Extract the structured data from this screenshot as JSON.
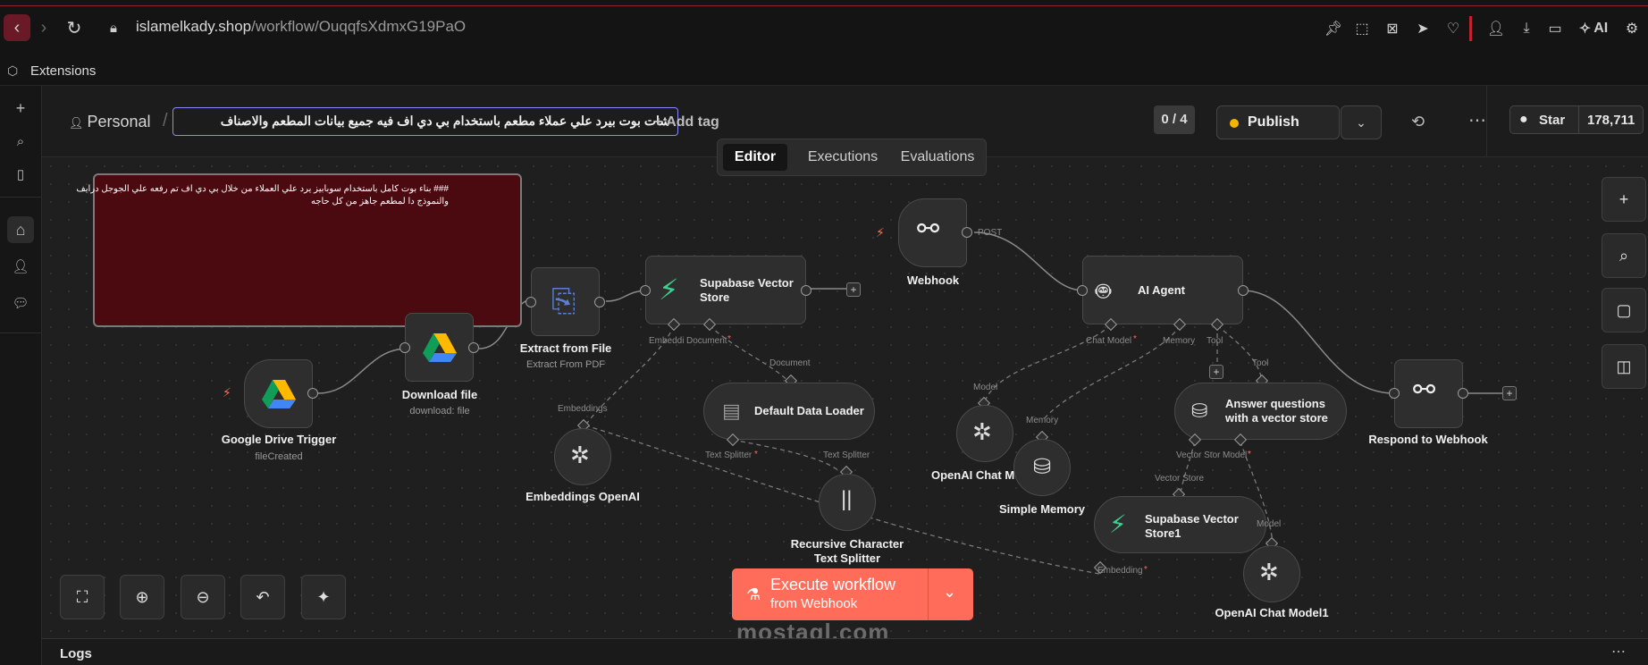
{
  "browser": {
    "url_host": "islamelkady.shop",
    "url_path": "/workflow/OuqqfsXdmxG19PaO",
    "ai_label": "AI",
    "extensions_label": "Extensions"
  },
  "header": {
    "project": "Personal",
    "separator": "/",
    "workflow_name": "شات بوت بيرد علي عملاء مطعم باستخدام  بي دي اف فيه جميع بيانات المطعم والاصناف",
    "add_tag": "+ Add tag",
    "counter": "0 / 4",
    "publish": "Publish",
    "star_label": "Star",
    "star_count": "178,711",
    "tabs": [
      "Editor",
      "Executions",
      "Evaluations"
    ],
    "active_tab": "Editor"
  },
  "sticky_note": {
    "line1": "### بناء بوت كامل باستخدام سوبابيز يرد علي العملاء من خلال بي دي اف تم رفعه علي الجوجل درايف",
    "line2": "والنموذج دا لمطعم جاهز من كل حاجه"
  },
  "nodes": {
    "google_drive_trigger": {
      "label": "Google Drive Trigger",
      "sub": "fileCreated"
    },
    "download_file": {
      "label": "Download file",
      "sub": "download: file"
    },
    "extract_from_file": {
      "label": "Extract from File",
      "sub": "Extract From PDF"
    },
    "supabase_vector_store": {
      "label": "Supabase Vector Store",
      "line1": "Supabase Vector",
      "line2": "Store"
    },
    "webhook": {
      "label": "Webhook",
      "port": "POST"
    },
    "ai_agent": {
      "label": "AI Agent"
    },
    "respond_to_webhook": {
      "label": "Respond to Webhook"
    },
    "default_data_loader": {
      "label": "Default Data Loader"
    },
    "embeddings_openai": {
      "label": "Embeddings OpenAI"
    },
    "recursive_splitter": {
      "line1": "Recursive Character",
      "line2": "Text Splitter"
    },
    "openai_chat_model": {
      "label": "OpenAI Chat M"
    },
    "simple_memory": {
      "label": "Simple Memory"
    },
    "answer_questions": {
      "line1": "Answer questions",
      "line2": "with a vector store"
    },
    "supabase_vector_store1": {
      "line1": "Supabase Vector",
      "line2": "Store1"
    },
    "openai_chat_model1": {
      "label": "OpenAI Chat Model1"
    }
  },
  "port_labels": {
    "embedding": "Embeddi",
    "document": "Document",
    "document2": "Document",
    "embeddings": "Embeddings",
    "text_splitter": "Text Splitter",
    "text_splitter2": "Text Splitter",
    "chat_model": "Chat Model",
    "memory": "Memory",
    "tool": "Tool",
    "model": "Model",
    "memory2": "Memory",
    "tool2": "Tool",
    "vector_store": "Vector Stor",
    "model2": "Model",
    "vector_store2": "Vector Store",
    "model3": "Model",
    "embedding2": "Embedding"
  },
  "execute": {
    "title": "Execute workflow",
    "sub": "from Webhook"
  },
  "logs_label": "Logs",
  "watermark": "mostaql.com",
  "colors": {
    "accent": "#ff6d5a",
    "sticky_bg": "#4a0a10",
    "publish_dot": "#f5b400"
  }
}
